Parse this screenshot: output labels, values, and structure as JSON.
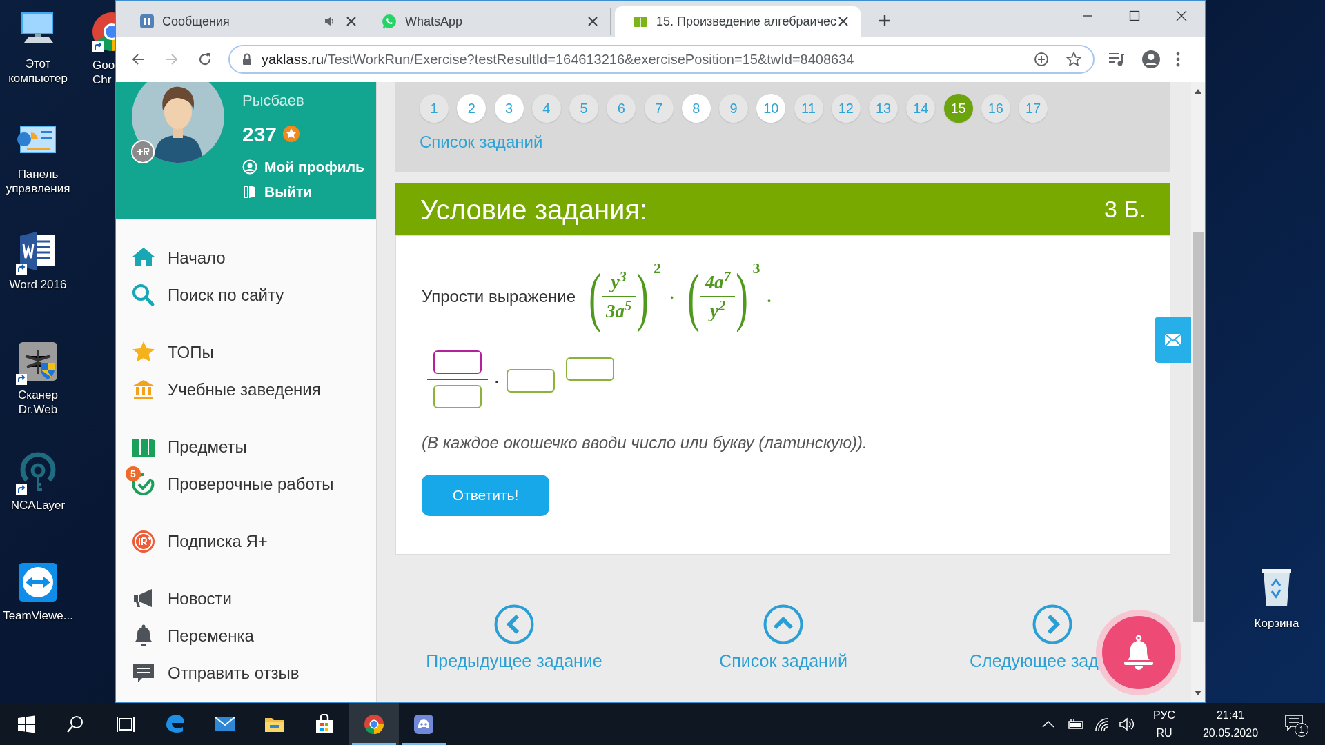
{
  "desktop": {
    "icons": [
      {
        "label": "Этот компьютер",
        "shortcut": false
      },
      {
        "label": "Панель управления",
        "shortcut": false
      },
      {
        "label": "Word 2016",
        "shortcut": true
      },
      {
        "label": "Сканер Dr.Web",
        "shortcut": true
      },
      {
        "label": "NCALayer",
        "shortcut": true
      },
      {
        "label": "TeamViewe...",
        "shortcut": false
      }
    ],
    "partial_icon": {
      "label_lines": [
        "Goo",
        "Chr"
      ],
      "shortcut": true
    },
    "recycle_bin": {
      "label": "Корзина"
    }
  },
  "browser": {
    "tabs": [
      {
        "title": "Сообщения",
        "selected": false,
        "audio": true
      },
      {
        "title": "WhatsApp",
        "selected": false,
        "audio": false
      },
      {
        "title": "15. Произведение алгебраичес",
        "selected": true,
        "audio": false
      }
    ],
    "url": {
      "host": "yaklass.ru",
      "path": "/TestWorkRun/Exercise?testResultId=164613216&exercisePosition=15&twId=8408634"
    }
  },
  "sidebar": {
    "profile": {
      "name_lines": [
        "Рысбаев"
      ],
      "points": "237",
      "links": [
        "Мой профиль",
        "Выйти"
      ]
    },
    "nav_groups": [
      [
        {
          "label": "Начало"
        },
        {
          "label": "Поиск по сайту"
        }
      ],
      [
        {
          "label": "ТОПы"
        },
        {
          "label": "Учебные заведения"
        }
      ],
      [
        {
          "label": "Предметы"
        },
        {
          "label": "Проверочные работы",
          "badge": "5"
        }
      ],
      [
        {
          "label": "Подписка Я+"
        }
      ],
      [
        {
          "label": "Новости"
        },
        {
          "label": "Переменка"
        },
        {
          "label": "Отправить отзыв"
        }
      ]
    ]
  },
  "exercise_nav": {
    "pages": [
      {
        "label": "1",
        "selected": false,
        "done": false
      },
      {
        "label": "2",
        "selected": false,
        "done": true
      },
      {
        "label": "3",
        "selected": false,
        "done": true
      },
      {
        "label": "4",
        "selected": false,
        "done": false
      },
      {
        "label": "5",
        "selected": false,
        "done": false
      },
      {
        "label": "6",
        "selected": false,
        "done": false
      },
      {
        "label": "7",
        "selected": false,
        "done": false
      },
      {
        "label": "8",
        "selected": false,
        "done": true
      },
      {
        "label": "9",
        "selected": false,
        "done": false
      },
      {
        "label": "10",
        "selected": false,
        "done": true
      },
      {
        "label": "11",
        "selected": false,
        "done": false
      },
      {
        "label": "12",
        "selected": false,
        "done": false
      },
      {
        "label": "13",
        "selected": false,
        "done": false
      },
      {
        "label": "14",
        "selected": false,
        "done": false
      },
      {
        "label": "15",
        "selected": true,
        "done": false
      },
      {
        "label": "16",
        "selected": false,
        "done": false
      },
      {
        "label": "17",
        "selected": false,
        "done": false
      }
    ],
    "list_link": "Список заданий"
  },
  "task": {
    "title": "Условие задания:",
    "points": "3 Б.",
    "prompt": "Упрости выражение",
    "formula": {
      "factors": [
        {
          "open": "(",
          "numerator": "y$^{3}$",
          "denominator": "3a$^{5}$",
          "close": ")",
          "power": "2"
        },
        {
          "open": "(",
          "numerator": "4a$^{7}$",
          "denominator": "y$^{2}$",
          "close": ")",
          "power": "3"
        }
      ],
      "operator": "·",
      "end": "."
    },
    "answer": {
      "operator": "·",
      "fields": [
        {
          "focused": true
        },
        {
          "focused": false
        },
        {
          "focused": false
        },
        {
          "focused": false
        }
      ]
    },
    "hint": "(В каждое окошечко вводи число или букву (латинскую)).",
    "submit": "Ответить!"
  },
  "bottom_nav": [
    {
      "kind": "prev",
      "label": "Предыдущее задание"
    },
    {
      "kind": "up",
      "label": "Список заданий"
    },
    {
      "kind": "next",
      "label": "Следующее зад"
    }
  ],
  "taskbar": {
    "apps": [
      {
        "active": false,
        "running": false
      },
      {
        "active": false,
        "running": false
      },
      {
        "active": false,
        "running": false
      },
      {
        "active": true,
        "running": true
      },
      {
        "active": false,
        "running": true
      }
    ],
    "language": "РУС",
    "layout": "RU",
    "time": "21:41",
    "date": "20.05.2020",
    "notifications": "1"
  }
}
